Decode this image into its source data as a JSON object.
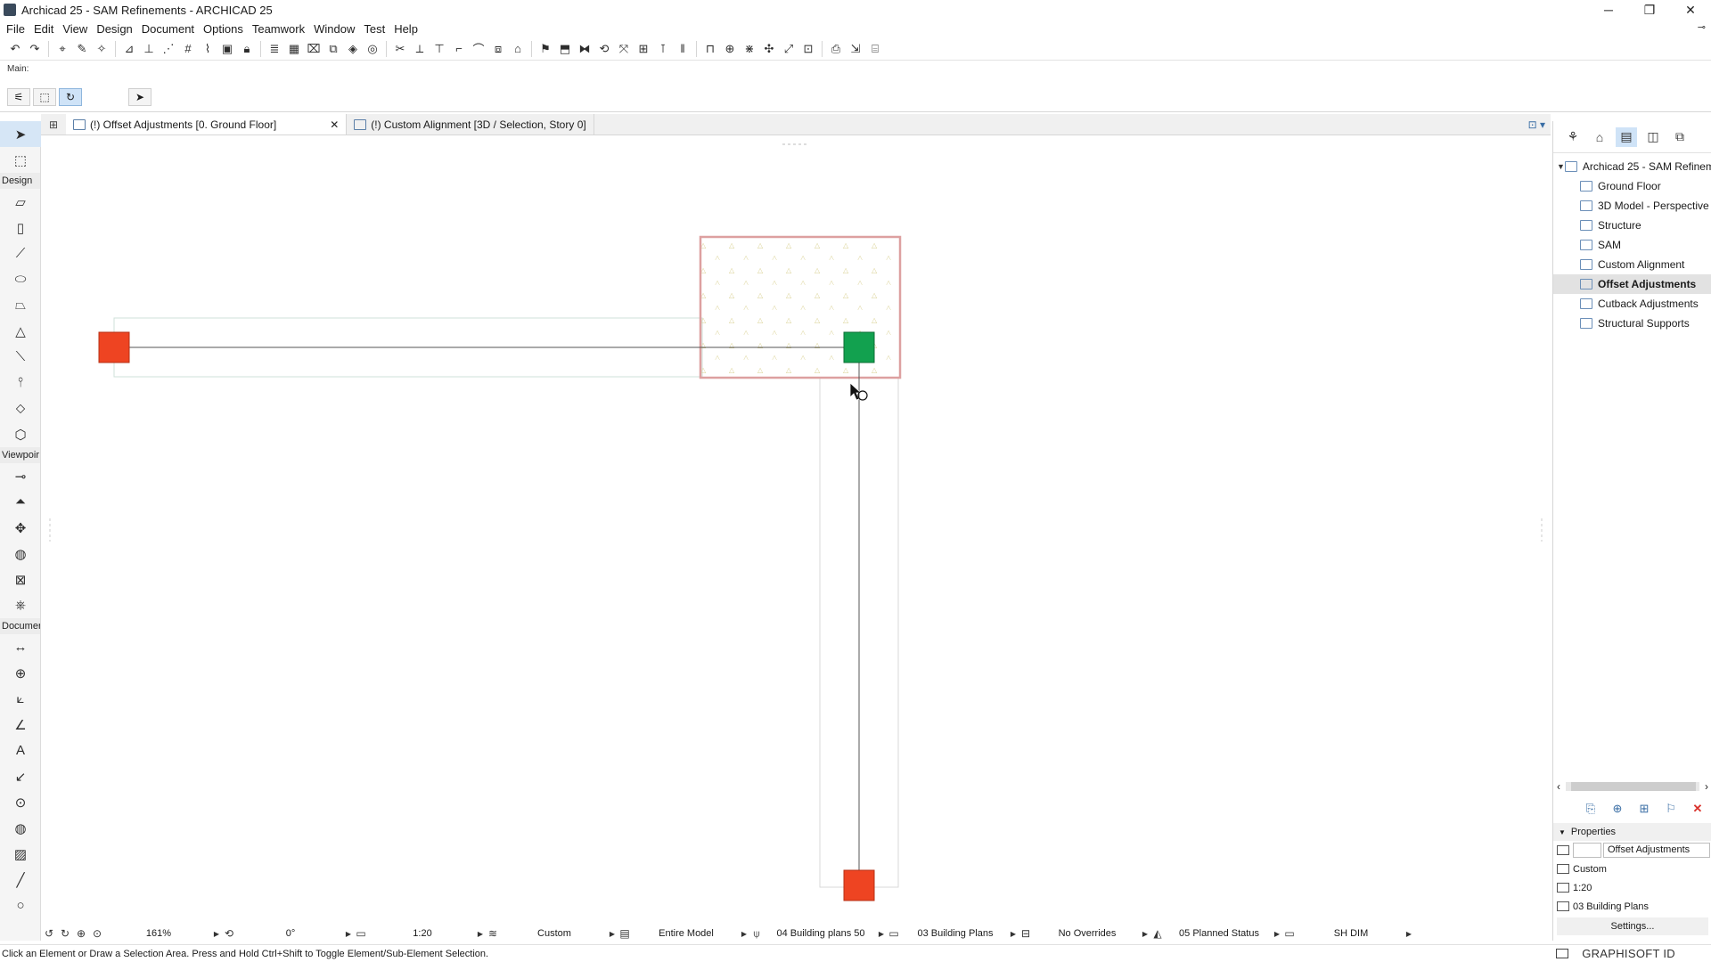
{
  "window": {
    "title": "Archicad 25 - SAM Refinements - ARCHICAD 25",
    "controls": {
      "minimize": "─",
      "restore": "❐",
      "close": "✕"
    }
  },
  "menu": [
    "File",
    "Edit",
    "View",
    "Design",
    "Document",
    "Options",
    "Teamwork",
    "Window",
    "Test",
    "Help"
  ],
  "infobox": {
    "label": "Main:"
  },
  "toolbox": {
    "sections": {
      "design": "Design",
      "viewpoint": "Viewpoir",
      "document": "Documer"
    }
  },
  "tabs": [
    {
      "label": "(!) Offset Adjustments [0. Ground Floor]",
      "active": true,
      "close": "✕"
    },
    {
      "label": "(!) Custom Alignment [3D / Selection, Story 0]",
      "active": false
    }
  ],
  "navigator": {
    "root": "Archicad 25 - SAM Refineme",
    "items": [
      {
        "label": "Ground Floor"
      },
      {
        "label": "3D Model - Perspective"
      },
      {
        "label": "Structure"
      },
      {
        "label": "SAM"
      },
      {
        "label": "Custom Alignment"
      },
      {
        "label": "Offset Adjustments",
        "selected": true
      },
      {
        "label": "Cutback Adjustments"
      },
      {
        "label": "Structural Supports"
      }
    ]
  },
  "properties": {
    "header": "Properties",
    "name": "Offset Adjustments",
    "rows": [
      "Custom",
      "1:20",
      "03 Building Plans"
    ],
    "settings_button": "Settings..."
  },
  "quick_options": {
    "zoom": "161%",
    "rotation": "0°",
    "scale": "1:20",
    "layer_combination": "Custom",
    "structure_display": "Entire Model",
    "pen_set": "04 Building plans 50",
    "model_view": "03 Building Plans",
    "graphic_overrides": "No Overrides",
    "renovation_filter": "05 Planned Status",
    "dimension": "SH DIM"
  },
  "status": {
    "message": "Click an Element or Draw a Selection Area. Press and Hold Ctrl+Shift to Toggle Element/Sub-Element Selection.",
    "brand": "GRAPHISOFT ID"
  },
  "colors": {
    "beam_end_red": "#ee4422",
    "beam_end_green": "#12a14f",
    "slab_outline": "#dda0a0",
    "hatch": "#d8d090",
    "selection_blue": "#cfe3f7"
  }
}
